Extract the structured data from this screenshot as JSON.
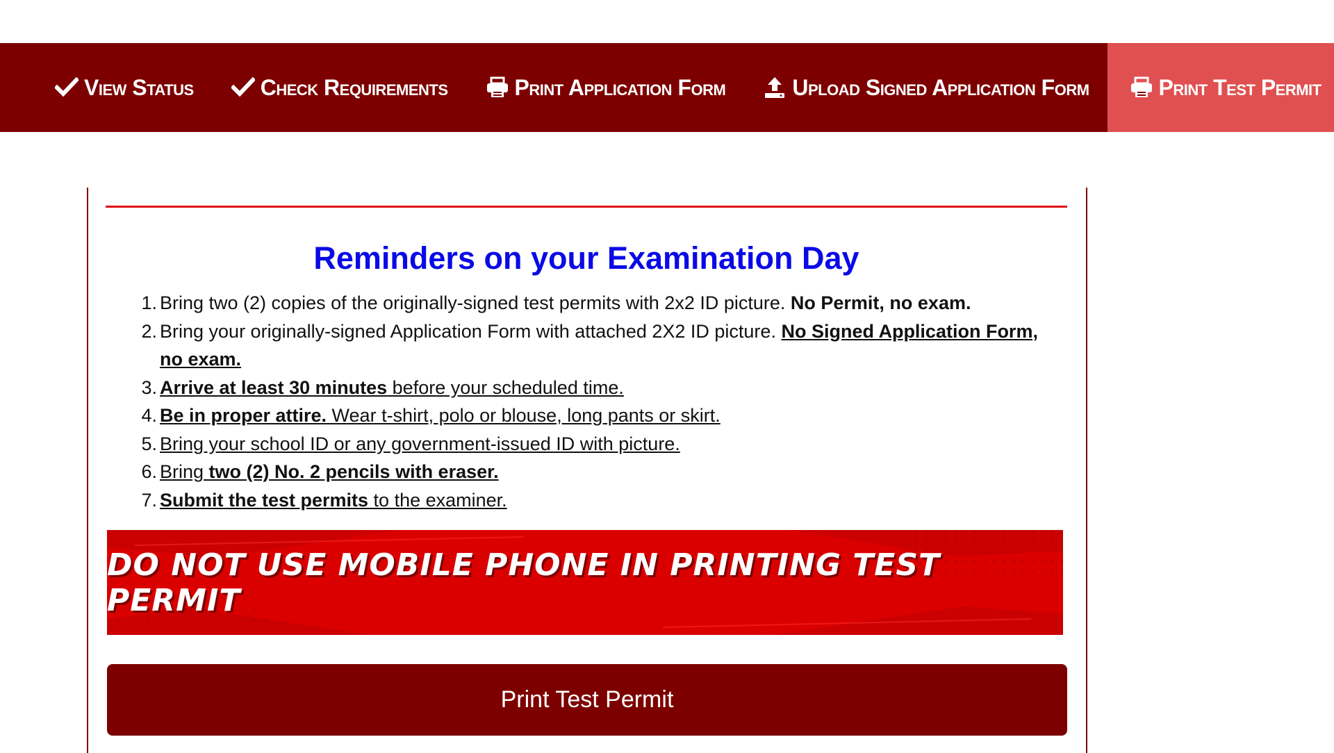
{
  "nav": {
    "items": [
      {
        "label": "View Status",
        "icon": "check-icon"
      },
      {
        "label": "Check Requirements",
        "icon": "check-icon"
      },
      {
        "label": "Print Application Form",
        "icon": "printer-icon"
      },
      {
        "label": "Upload Signed Application Form",
        "icon": "upload-icon"
      },
      {
        "label": "Print Test Permit",
        "icon": "printer-icon",
        "active": true
      },
      {
        "label": "",
        "icon": "home-icon"
      }
    ],
    "colors": {
      "bar": "#7d0000",
      "active": "#e05050",
      "text": "#ffffff"
    }
  },
  "reminders": {
    "title": "Reminders on your Examination Day",
    "title_color": "#0a0ae6",
    "items": [
      {
        "num": "1.",
        "parts": [
          {
            "t": "Bring two (2) copies of the originally-signed test permits with 2x2 ID picture. "
          },
          {
            "t": "No Permit, no exam.",
            "bold": true
          }
        ]
      },
      {
        "num": "2.",
        "parts": [
          {
            "t": "Bring your originally-signed Application Form with attached 2X2 ID picture. "
          },
          {
            "t": "No Signed Application Form, no exam.",
            "bold": true,
            "underline": true
          }
        ]
      },
      {
        "num": "3.",
        "parts": [
          {
            "t": "Arrive at least 30 minutes",
            "bold": true,
            "underline": true
          },
          {
            "t": " before your scheduled time.",
            "underline": true
          }
        ]
      },
      {
        "num": "4.",
        "parts": [
          {
            "t": "Be in proper attire.",
            "bold": true,
            "underline": true
          },
          {
            "t": " Wear t-shirt, polo or blouse, long pants or skirt.",
            "underline": true
          }
        ]
      },
      {
        "num": "5.",
        "parts": [
          {
            "t": "Bring your school ID or any government-issued ID with picture.",
            "underline": true
          }
        ]
      },
      {
        "num": "6.",
        "parts": [
          {
            "t": "Bring",
            "underline": true
          },
          {
            "t": " two (2) No. 2 pencils with eraser.",
            "bold": true,
            "underline": true
          }
        ]
      },
      {
        "num": "7.",
        "parts": [
          {
            "t": "Submit the test permits",
            "bold": true,
            "underline": true
          },
          {
            "t": " to the examiner.",
            "underline": true
          }
        ]
      }
    ]
  },
  "banner": {
    "text": "DO NOT USE MOBILE PHONE IN PRINTING TEST PERMIT",
    "color": "#db0000"
  },
  "actions": {
    "print_label": "Print Test Permit",
    "button_color": "#7d0000"
  }
}
